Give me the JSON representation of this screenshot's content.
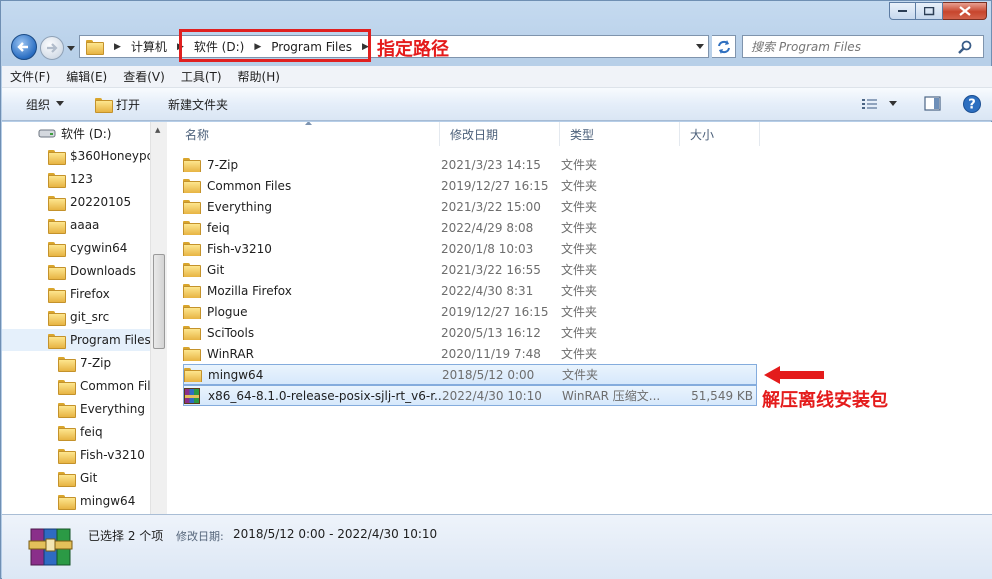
{
  "address": {
    "computer": "计算机",
    "drive": "软件 (D:)",
    "folder": "Program Files"
  },
  "search": {
    "placeholder": "搜索 Program Files"
  },
  "annotations": {
    "path_note": "指定路径",
    "extract_note": "解压离线安装包"
  },
  "menu": [
    "文件(F)",
    "编辑(E)",
    "查看(V)",
    "工具(T)",
    "帮助(H)"
  ],
  "toolbar": {
    "organize": "组织",
    "open": "打开",
    "new_folder": "新建文件夹"
  },
  "nav": {
    "drive": "软件 (D:)",
    "items": [
      "$360Honeypc",
      "123",
      "20220105",
      "aaaa",
      "cygwin64",
      "Downloads",
      "Firefox",
      "git_src",
      "Program Files"
    ],
    "subitems": [
      "7-Zip",
      "Common Fil",
      "Everything",
      "feiq",
      "Fish-v3210",
      "Git",
      "mingw64"
    ]
  },
  "columns": {
    "name": "名称",
    "date": "修改日期",
    "type": "类型",
    "size": "大小"
  },
  "files": [
    {
      "name": "7-Zip",
      "date": "2021/3/23 14:15",
      "type": "文件夹",
      "size": ""
    },
    {
      "name": "Common Files",
      "date": "2019/12/27 16:15",
      "type": "文件夹",
      "size": ""
    },
    {
      "name": "Everything",
      "date": "2021/3/22 15:00",
      "type": "文件夹",
      "size": ""
    },
    {
      "name": "feiq",
      "date": "2022/4/29 8:08",
      "type": "文件夹",
      "size": ""
    },
    {
      "name": "Fish-v3210",
      "date": "2020/1/8 10:03",
      "type": "文件夹",
      "size": ""
    },
    {
      "name": "Git",
      "date": "2021/3/22 16:55",
      "type": "文件夹",
      "size": ""
    },
    {
      "name": "Mozilla Firefox",
      "date": "2022/4/30 8:31",
      "type": "文件夹",
      "size": ""
    },
    {
      "name": "Plogue",
      "date": "2019/12/27 16:15",
      "type": "文件夹",
      "size": ""
    },
    {
      "name": "SciTools",
      "date": "2020/5/13 16:12",
      "type": "文件夹",
      "size": ""
    },
    {
      "name": "WinRAR",
      "date": "2020/11/19 7:48",
      "type": "文件夹",
      "size": ""
    },
    {
      "name": "mingw64",
      "date": "2018/5/12 0:00",
      "type": "文件夹",
      "size": "",
      "selected": true
    },
    {
      "name": "x86_64-8.1.0-release-posix-sjlj-rt_v6-r...",
      "date": "2022/4/30 10:10",
      "type": "WinRAR 压缩文...",
      "size": "51,549 KB",
      "selected": true,
      "archive": true
    }
  ],
  "status": {
    "selection": "已选择 2 个项",
    "date_label": "修改日期:",
    "date_range": "2018/5/12 0:00 - 2022/4/30 10:10"
  },
  "colors": {
    "annotation_red": "#e41b1b",
    "selection_blue": "#84acdd"
  }
}
